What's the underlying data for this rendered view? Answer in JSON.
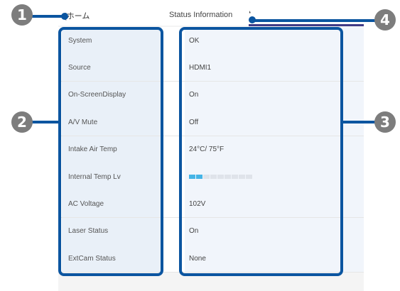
{
  "header": {
    "home_label": "ホーム",
    "title": "Status Information"
  },
  "rows": [
    {
      "label": "System",
      "value": "OK"
    },
    {
      "label": "Source",
      "value": "HDMI1"
    },
    {
      "label": "On-ScreenDisplay",
      "value": "On"
    },
    {
      "label": "A/V Mute",
      "value": "Off"
    },
    {
      "label": "Intake Air Temp",
      "value": "24°C/ 75°F"
    },
    {
      "label": "Internal Temp Lv",
      "value": "",
      "level": {
        "filled": 2,
        "total": 9
      }
    },
    {
      "label": "AC Voltage",
      "value": "102V"
    },
    {
      "label": "Laser Status",
      "value": "On"
    },
    {
      "label": "ExtCam Status",
      "value": "None"
    }
  ],
  "callouts": [
    "1",
    "2",
    "3",
    "4"
  ],
  "colors": {
    "callout_badge": "#7d7d7d",
    "callout_line": "#0b55a0",
    "header_underline": "#3f3a86",
    "level_filled": "#45b4e6"
  }
}
